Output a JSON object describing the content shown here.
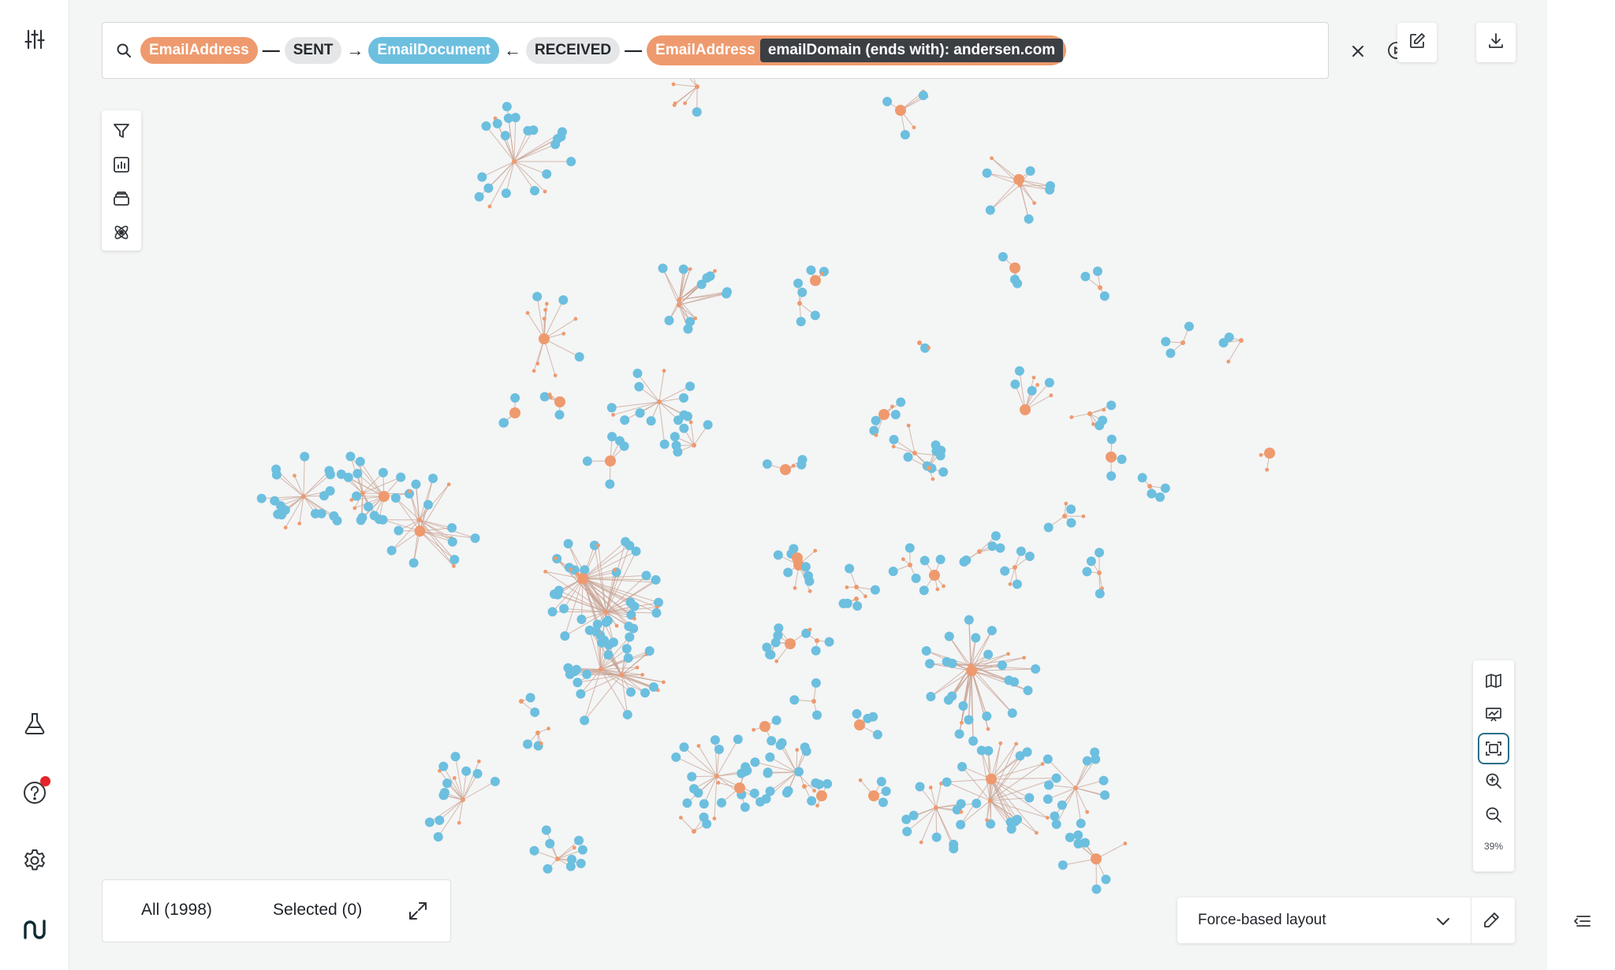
{
  "colors": {
    "address_node": "#ee9a6e",
    "document_node": "#6cbfdf",
    "edge": "#c8a394",
    "accent": "#2a6f86",
    "notification": "#e5242b"
  },
  "query": {
    "search_icon": "search-icon",
    "node1": "EmailAddress",
    "rel1_prefix": "—",
    "rel1": "SENT",
    "rel1_suffix": "→",
    "node2": "EmailDocument",
    "rel2_prefix": "←",
    "rel2": "RECEIVED",
    "rel2_suffix": "—",
    "node3": "EmailAddress",
    "condition": "emailDomain (ends with): andersen.com",
    "clear_icon": "close-icon",
    "run_icon": "play-circle-icon"
  },
  "toolbar_icons": [
    "filter-icon",
    "chart-icon",
    "layers-icon",
    "atom-icon"
  ],
  "zoom_panel": {
    "icons": [
      "map-icon",
      "presentation-chart-icon",
      "fit-screen-icon",
      "zoom-in-icon",
      "zoom-out-icon"
    ],
    "zoom_level": "39%"
  },
  "counters": {
    "all": "All (1998)",
    "selected": "Selected (0)"
  },
  "layout": {
    "selected": "Force-based layout"
  },
  "nav_icons": [
    "sliders-icon",
    "flask-icon",
    "help-icon",
    "settings-icon",
    "logo-icon"
  ]
}
